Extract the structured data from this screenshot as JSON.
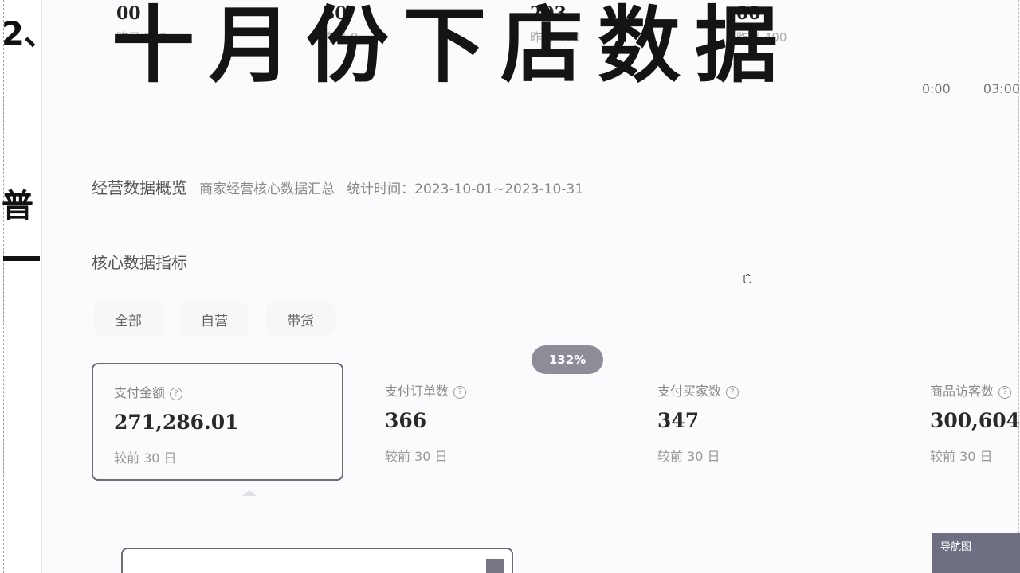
{
  "left": {
    "number": "2、",
    "char": "普"
  },
  "top_stats": [
    {
      "value": "00",
      "sub": "昨日 240"
    },
    {
      "value": "30",
      "sub": "昨日 0"
    },
    {
      "value": "203",
      "sub": "昨日 400"
    },
    {
      "value": "00",
      "sub": "昨日 400"
    }
  ],
  "overlay_title": "十月份下店数据",
  "time_labels": [
    "0:00",
    "03:00"
  ],
  "overview": {
    "title": "经营数据概览",
    "desc": "商家经营核心数据汇总",
    "period": "统计时间：2023-10-01~2023-10-31"
  },
  "core_title": "核心数据指标",
  "tabs": [
    "全部",
    "自营",
    "带货"
  ],
  "badge": "132%",
  "metrics": [
    {
      "label": "支付金额",
      "value": "271,286.01",
      "compare": "较前 30 日",
      "active": true
    },
    {
      "label": "支付订单数",
      "value": "366",
      "compare": "较前 30 日",
      "active": false
    },
    {
      "label": "支付买家数",
      "value": "347",
      "compare": "较前 30 日",
      "active": false
    },
    {
      "label": "商品访客数",
      "value": "300,604",
      "compare": "较前 30 日",
      "active": false
    }
  ],
  "nav_chip": "导航图",
  "colors": {
    "accent_border": "#6c6c78",
    "badge_bg": "#8d8d98",
    "background": "#fbfbfd"
  }
}
